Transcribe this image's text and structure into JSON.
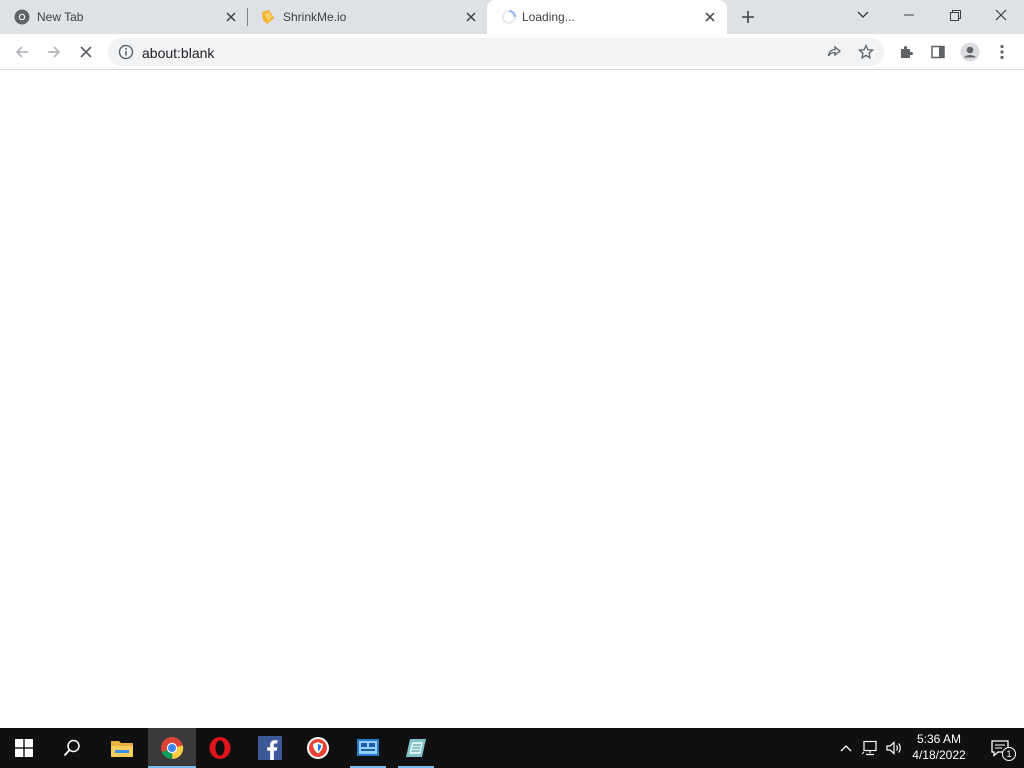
{
  "browser": {
    "tabs": [
      {
        "title": "New Tab",
        "favicon": "chrome-icon",
        "active": false
      },
      {
        "title": "ShrinkMe.io",
        "favicon": "shrinkme-icon",
        "active": false
      },
      {
        "title": "Loading...",
        "favicon": "loading-spinner-icon",
        "active": true
      }
    ],
    "address_bar": {
      "url": "about:blank",
      "security_icon": "info-icon"
    },
    "colors": {
      "tab_strip": "#dee1e6",
      "omnibox": "#f1f3f4",
      "accent": "#1a73e8"
    }
  },
  "taskbar": {
    "pinned": [
      {
        "name": "file-explorer",
        "icon": "folder-icon"
      },
      {
        "name": "chrome",
        "icon": "chrome-icon",
        "active": true
      },
      {
        "name": "opera",
        "icon": "opera-icon"
      },
      {
        "name": "facebook",
        "icon": "facebook-icon"
      },
      {
        "name": "browser-shield",
        "icon": "shield-browser-icon"
      },
      {
        "name": "control-panel",
        "icon": "control-panel-icon"
      },
      {
        "name": "notepad-tool",
        "icon": "notepad-icon"
      }
    ],
    "clock": {
      "time": "5:36 AM",
      "date": "4/18/2022"
    },
    "notifications": {
      "count": "1"
    }
  }
}
